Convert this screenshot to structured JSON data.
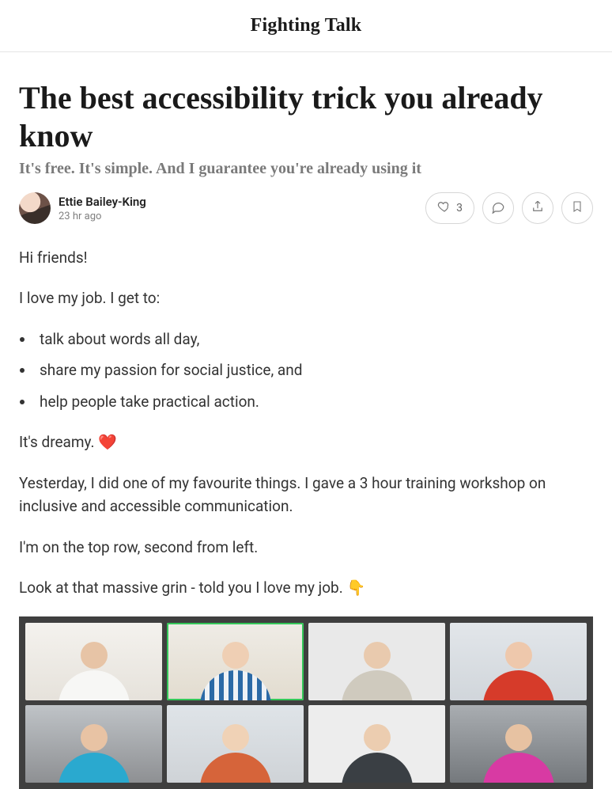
{
  "site": {
    "name": "Fighting Talk"
  },
  "post": {
    "title": "The best accessibility trick you already know",
    "subtitle": "It's free. It's simple. And I guarantee you're already using it",
    "author": "Ettie Bailey-King",
    "time": "23 hr ago",
    "likes": "3"
  },
  "body": {
    "p1": "Hi friends!",
    "p2": "I love my job. I get to:",
    "li1": "talk about words all day,",
    "li2": "share my passion for social justice, and",
    "li3": "help people take practical action.",
    "p3": "It's dreamy. ❤️",
    "p4": "Yesterday, I did one of my favourite things. I gave a 3 hour training workshop on inclusive and accessible communication.",
    "p5": "I'm on the top row, second from left.",
    "p6": "Look at that massive grin - told you I love my job. 👇"
  }
}
